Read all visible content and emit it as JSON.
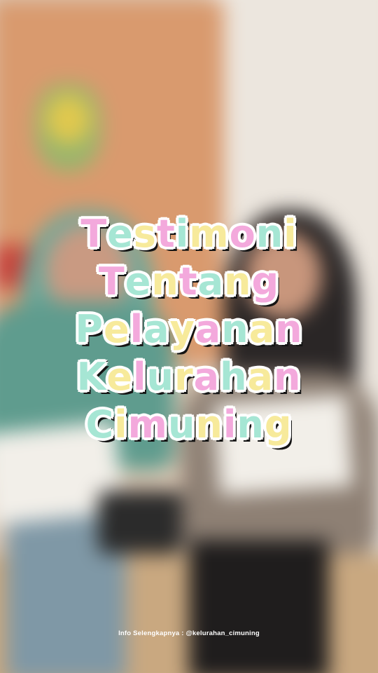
{
  "title": {
    "lines": [
      "Testimoni",
      "Tentang",
      "Pelayanan",
      "Kelurahan",
      "Cimuning"
    ],
    "palette": [
      "#f3a9dc",
      "#a6e6d4",
      "#f7ea9b"
    ]
  },
  "footer": {
    "text": "Info Selengkapnya : @kelurahan_cimuning"
  },
  "colors": {
    "text_outline": "#141414",
    "text_halo": "#ffffff"
  }
}
